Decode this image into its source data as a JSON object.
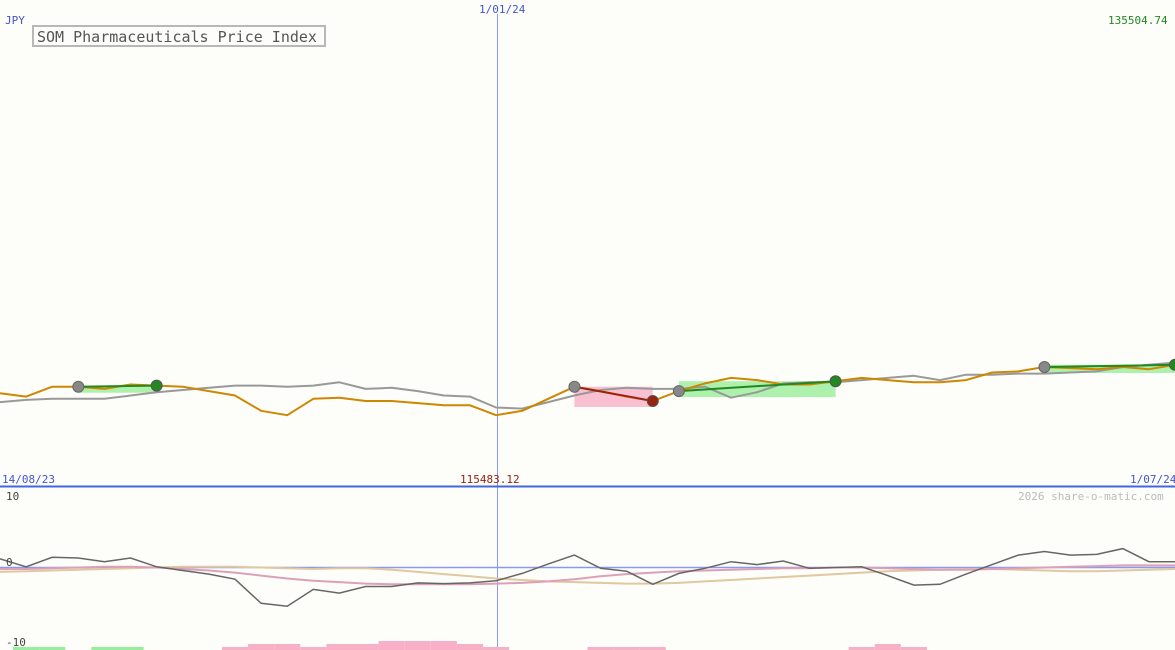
{
  "chart_data": {
    "type": "line",
    "title": "SOM Pharmaceuticals Price Index",
    "currency": "JPY",
    "watermark": "2026 share-o-matic.com",
    "labels": {
      "date_start": "14/08/23",
      "date_mid": "1/01/24",
      "date_end": "1/07/24",
      "price_high": "135504.74",
      "price_low": "115483.12"
    },
    "ylim": [
      114700,
      135504.74
    ],
    "price_series": [
      {
        "name": "",
        "color": "#cc8800",
        "values": [
          118200,
          118050,
          118500,
          118500,
          118400,
          118600,
          118550,
          118500,
          118300,
          118100,
          117400,
          117200,
          117950,
          118000,
          117850,
          117850,
          117750,
          117650,
          117650,
          117200,
          117400,
          117950,
          118500,
          118300,
          118050,
          117850,
          118300,
          118650,
          118900,
          118800,
          118600,
          118600,
          118750,
          118900,
          118800,
          118700,
          118700,
          118800,
          119150,
          119200,
          119400,
          119350,
          119300,
          119400,
          119300,
          119500
        ]
      },
      {
        "name": "",
        "color": "#999999",
        "values": [
          117800,
          117900,
          117950,
          117950,
          117950,
          118100,
          118250,
          118350,
          118450,
          118550,
          118550,
          118500,
          118550,
          118700,
          118400,
          118450,
          118300,
          118100,
          118050,
          117550,
          117500,
          117800,
          118100,
          118350,
          118450,
          118400,
          118400,
          118500,
          118000,
          118250,
          118650,
          118700,
          118700,
          118800,
          118900,
          119000,
          118800,
          119050,
          119050,
          119100,
          119100,
          119150,
          119200,
          119400,
          119500,
          119600
        ]
      }
    ],
    "trend_segments": [
      {
        "from": 3,
        "to": 6,
        "color": "#228822"
      },
      {
        "from": 22,
        "to": 25,
        "color": "#992211"
      },
      {
        "from": 26,
        "to": 32,
        "color": "#228822"
      },
      {
        "from": 40,
        "to": 45,
        "color": "#228822"
      }
    ],
    "oscillator": {
      "ylim": [
        -10,
        10
      ],
      "ticks": [
        "10",
        "0",
        "-10"
      ],
      "main": {
        "color": "#666666",
        "values": [
          1.4,
          0.3,
          1.6,
          1.5,
          1.0,
          1.5,
          0.3,
          -0.2,
          -0.7,
          -1.4,
          -4.7,
          -5.1,
          -2.8,
          -3.3,
          -2.4,
          -2.4,
          -1.9,
          -2.0,
          -1.9,
          -1.6,
          -0.6,
          0.7,
          1.9,
          0.1,
          -0.3,
          -2.1,
          -0.6,
          0.1,
          1.0,
          0.6,
          1.1,
          0.1,
          0.2,
          0.3,
          -0.9,
          -2.2,
          -2.1,
          -0.7,
          0.6,
          1.9,
          2.4,
          1.9,
          2.0,
          2.8,
          1.0,
          1.0
        ]
      },
      "signal_a": {
        "color": "#dda0b8",
        "values": [
          0.0,
          0.0,
          0.1,
          0.2,
          0.3,
          0.3,
          0.2,
          0.0,
          -0.2,
          -0.5,
          -0.9,
          -1.3,
          -1.6,
          -1.8,
          -2.0,
          -2.1,
          -2.1,
          -2.1,
          -2.1,
          -2.0,
          -1.9,
          -1.7,
          -1.4,
          -1.0,
          -0.7,
          -0.5,
          -0.3,
          -0.2,
          -0.1,
          0.0,
          0.1,
          0.1,
          0.2,
          0.2,
          0.1,
          0.0,
          -0.1,
          -0.1,
          0.0,
          0.1,
          0.2,
          0.3,
          0.4,
          0.5,
          0.5,
          0.5
        ]
      },
      "signal_b": {
        "color": "#e0c8a0",
        "values": [
          -0.4,
          -0.3,
          -0.2,
          -0.1,
          0.0,
          0.1,
          0.2,
          0.3,
          0.3,
          0.3,
          0.2,
          0.1,
          0.0,
          0.1,
          0.1,
          -0.1,
          -0.4,
          -0.7,
          -1.0,
          -1.3,
          -1.5,
          -1.7,
          -1.8,
          -1.9,
          -2.0,
          -2.0,
          -1.9,
          -1.7,
          -1.5,
          -1.3,
          -1.1,
          -0.9,
          -0.7,
          -0.5,
          -0.3,
          -0.2,
          -0.1,
          0.0,
          0.0,
          -0.1,
          -0.2,
          -0.3,
          -0.3,
          -0.2,
          -0.1,
          0.0
        ]
      },
      "histogram": {
        "positive_color": "#99ee99",
        "negative_color": "#f8b0c8",
        "values": [
          0,
          1,
          1,
          0,
          1,
          1,
          0,
          0,
          0,
          -1,
          -2,
          -2,
          -1,
          -2,
          -2,
          -3,
          -3,
          -3,
          -2,
          -1,
          0,
          0,
          0,
          -1,
          -1,
          -1,
          0,
          0,
          0,
          0,
          0,
          0,
          0,
          -1,
          -2,
          -1,
          0,
          0,
          0,
          0,
          0,
          0,
          0,
          0,
          0,
          0
        ]
      }
    }
  }
}
